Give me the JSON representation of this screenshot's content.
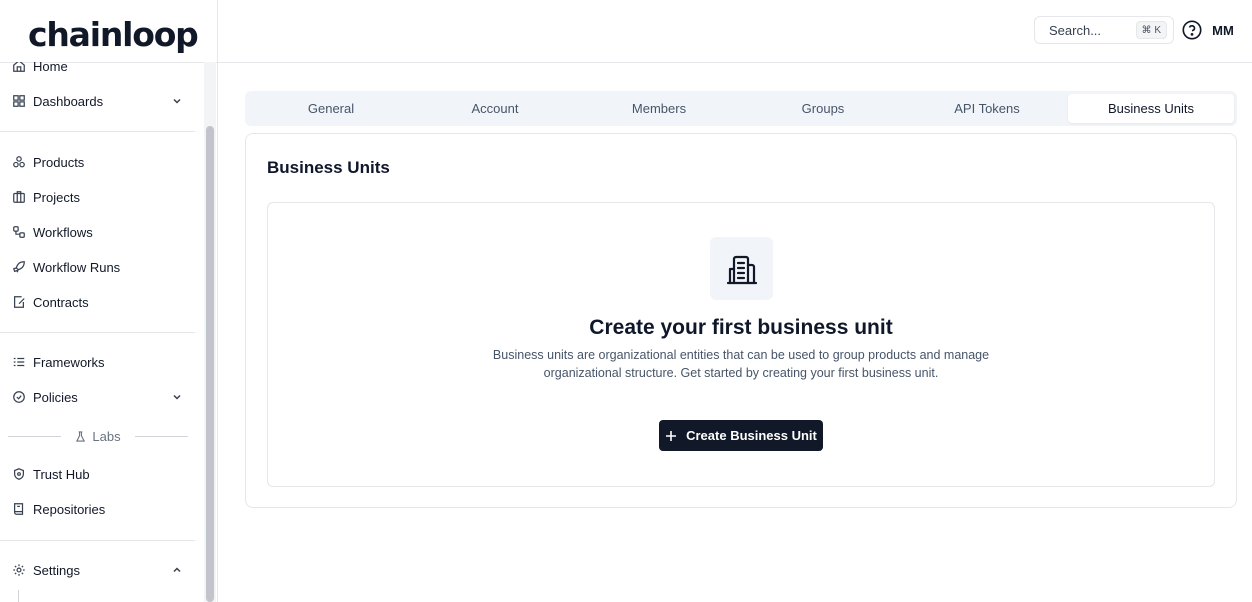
{
  "brand": {
    "logo_text": "chainloop"
  },
  "sidebar": {
    "items": [
      {
        "label": "Home",
        "icon": "home-icon"
      },
      {
        "label": "Dashboards",
        "icon": "dashboards-icon"
      },
      {
        "label": "Products",
        "icon": "products-icon"
      },
      {
        "label": "Projects",
        "icon": "projects-icon"
      },
      {
        "label": "Workflows",
        "icon": "workflows-icon"
      },
      {
        "label": "Workflow Runs",
        "icon": "rocket-icon"
      },
      {
        "label": "Contracts",
        "icon": "contracts-icon"
      },
      {
        "label": "Frameworks",
        "icon": "frameworks-icon"
      },
      {
        "label": "Policies",
        "icon": "policies-icon"
      },
      {
        "label": "Trust Hub",
        "icon": "trust-hub-icon"
      },
      {
        "label": "Repositories",
        "icon": "repositories-icon"
      },
      {
        "label": "Settings",
        "icon": "gear-icon"
      }
    ],
    "labs_label": "Labs"
  },
  "header": {
    "search_placeholder": "Search...",
    "search_shortcut": "⌘ K",
    "avatar_initials": "MM"
  },
  "tabs": [
    {
      "label": "General"
    },
    {
      "label": "Account"
    },
    {
      "label": "Members"
    },
    {
      "label": "Groups"
    },
    {
      "label": "API Tokens"
    },
    {
      "label": "Business Units",
      "active": true
    }
  ],
  "main": {
    "card_title": "Business Units",
    "empty_title": "Create your first business unit",
    "empty_description": "Business units are organizational entities that can be used to group products and manage organizational structure. Get started by creating your first business unit.",
    "cta_label": "Create Business Unit"
  },
  "colors": {
    "primary_button": "#111827",
    "tab_bg": "#f1f5f9",
    "border": "#e5e7eb",
    "muted_text": "#475569"
  }
}
